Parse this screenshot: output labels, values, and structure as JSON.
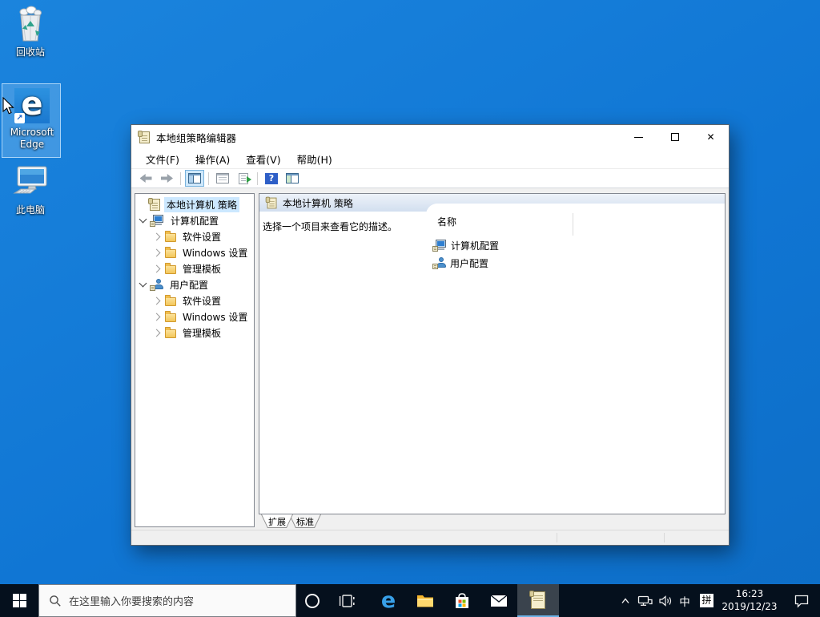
{
  "desktop": {
    "recycle_bin_label": "回收站",
    "edge_label_line1": "Microsoft",
    "edge_label_line2": "Edge",
    "edge_glyph": "e",
    "shortcut_arrow_glyph": "↗",
    "this_pc_label": "此电脑"
  },
  "window": {
    "title": "本地组策略编辑器",
    "close_glyph": "✕",
    "menu": {
      "file": "文件(F)",
      "action": "操作(A)",
      "view": "查看(V)",
      "help": "帮助(H)"
    },
    "toolbar": {
      "help_glyph": "?"
    },
    "tree": {
      "items": [
        {
          "label": "本地计算机 策略"
        },
        {
          "label": "计算机配置"
        },
        {
          "label": "软件设置"
        },
        {
          "label": "Windows 设置"
        },
        {
          "label": "管理模板"
        },
        {
          "label": "用户配置"
        },
        {
          "label": "软件设置"
        },
        {
          "label": "Windows 设置"
        },
        {
          "label": "管理模板"
        }
      ]
    },
    "content": {
      "header_title": "本地计算机 策略",
      "description": "选择一个项目来查看它的描述。",
      "column_name": "名称",
      "items": [
        {
          "label": "计算机配置"
        },
        {
          "label": "用户配置"
        }
      ]
    },
    "tabs": {
      "extended": "扩展",
      "standard": "标准"
    }
  },
  "taskbar": {
    "search_placeholder": "在这里输入你要搜索的内容",
    "tray": {
      "ime_lang": "中",
      "ime_mode": "拼",
      "time": "16:23",
      "date": "2019/12/23"
    }
  }
}
